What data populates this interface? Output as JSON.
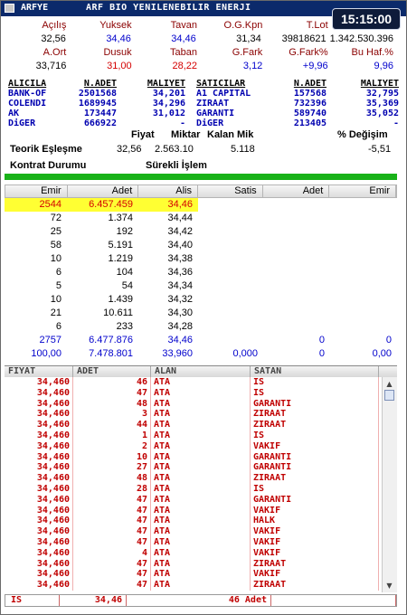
{
  "title": {
    "symbol": "ARFYE",
    "name": "ARF BIO YENILENEBILIR ENERJI",
    "clock": "15:15:00"
  },
  "quote": {
    "row1_headers": [
      "Açılış",
      "Yuksek",
      "Tavan",
      "O.G.Kpn",
      "T.Lot",
      "Ciro/cim"
    ],
    "row1_values": [
      "32,56",
      "34,46",
      "34,46",
      "31,34",
      "39818621",
      "1.342.530.396"
    ],
    "row2_headers": [
      "A.Ort",
      "Dusuk",
      "Taban",
      "G.Fark",
      "G.Fark%",
      "Bu Haf.%"
    ],
    "row2_values": [
      "33,716",
      "31,00",
      "28,22",
      "3,12",
      "+9,96",
      "9,96"
    ]
  },
  "brokers": {
    "headers": [
      "ALICILA",
      "N.ADET",
      "MALIYET",
      "SATICILAR",
      "N.ADET",
      "MALIYET"
    ],
    "rows": [
      [
        "BANK-OF",
        "2501568",
        "34,201",
        "A1 CAPITAL",
        "157568",
        "32,795"
      ],
      [
        "COLENDI",
        "1689945",
        "34,296",
        "ZIRAAT",
        "732396",
        "35,369"
      ],
      [
        "AK",
        "173447",
        "31,012",
        "GARANTI",
        "589740",
        "35,052"
      ],
      [
        "DiGER",
        "666922",
        "-",
        "DiGER",
        "213405",
        "-"
      ]
    ]
  },
  "theoretical": {
    "h_price": "Fiyat",
    "h_qty": "Miktar",
    "h_rem": "Kalan Mik",
    "h_change": "% Değişim",
    "label1": "Teorik Eşleşme",
    "price": "32,56",
    "qty": "2.563.10",
    "rem": "5.118",
    "change": "-5,51",
    "label2": "Kontrat Durumu",
    "status": "Sürekli İşlem"
  },
  "depth": {
    "headers": [
      "Emir",
      "Adet",
      "Alis",
      "Satis",
      "Adet",
      "Emir"
    ],
    "rows": [
      [
        "2544",
        "6.457.459",
        "34,46",
        "",
        "",
        ""
      ],
      [
        "72",
        "1.374",
        "34,44",
        "",
        "",
        ""
      ],
      [
        "25",
        "192",
        "34,42",
        "",
        "",
        ""
      ],
      [
        "58",
        "5.191",
        "34,40",
        "",
        "",
        ""
      ],
      [
        "10",
        "1.219",
        "34,38",
        "",
        "",
        ""
      ],
      [
        "6",
        "104",
        "34,36",
        "",
        "",
        ""
      ],
      [
        "5",
        "54",
        "34,34",
        "",
        "",
        ""
      ],
      [
        "10",
        "1.439",
        "34,32",
        "",
        "",
        ""
      ],
      [
        "21",
        "10.611",
        "34,30",
        "",
        "",
        ""
      ],
      [
        "6",
        "233",
        "34,28",
        "",
        "",
        ""
      ]
    ],
    "sum1": [
      "2757",
      "6.477.876",
      "34,46",
      "",
      "0",
      "0"
    ],
    "sum2": [
      "100,00",
      "7.478.801",
      "33,960",
      "0,000",
      "0",
      "0,00"
    ]
  },
  "trades": {
    "headers": [
      "FIYAT",
      "ADET",
      "ALAN",
      "SATAN"
    ],
    "rows": [
      [
        "34,460",
        "46",
        "ATA",
        "IS"
      ],
      [
        "34,460",
        "47",
        "ATA",
        "IS"
      ],
      [
        "34,460",
        "48",
        "ATA",
        "GARANTI"
      ],
      [
        "34,460",
        "3",
        "ATA",
        "ZIRAAT"
      ],
      [
        "34,460",
        "44",
        "ATA",
        "ZIRAAT"
      ],
      [
        "34,460",
        "1",
        "ATA",
        "IS"
      ],
      [
        "34,460",
        "2",
        "ATA",
        "VAKIF"
      ],
      [
        "34,460",
        "10",
        "ATA",
        "GARANTI"
      ],
      [
        "34,460",
        "27",
        "ATA",
        "GARANTI"
      ],
      [
        "34,460",
        "48",
        "ATA",
        "ZIRAAT"
      ],
      [
        "34,460",
        "28",
        "ATA",
        "IS"
      ],
      [
        "34,460",
        "47",
        "ATA",
        "GARANTI"
      ],
      [
        "34,460",
        "47",
        "ATA",
        "VAKIF"
      ],
      [
        "34,460",
        "47",
        "ATA",
        "HALK"
      ],
      [
        "34,460",
        "47",
        "ATA",
        "VAKIF"
      ],
      [
        "34,460",
        "47",
        "ATA",
        "VAKIF"
      ],
      [
        "34,460",
        "4",
        "ATA",
        "VAKIF"
      ],
      [
        "34,460",
        "47",
        "ATA",
        "ZIRAAT"
      ],
      [
        "34,460",
        "47",
        "ATA",
        "VAKIF"
      ],
      [
        "34,460",
        "47",
        "ATA",
        "ZIRAAT"
      ]
    ]
  },
  "status_bar": {
    "broker": "IS",
    "price": "34,46",
    "qty": "46 Adet",
    "extra": ""
  }
}
